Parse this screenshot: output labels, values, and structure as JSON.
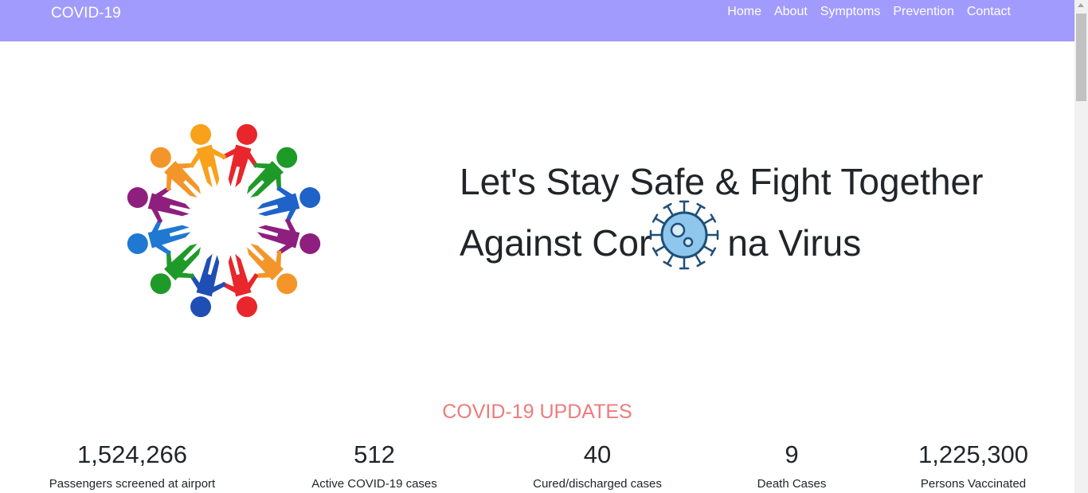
{
  "navbar": {
    "brand": "COVID-19",
    "links": [
      "Home",
      "About",
      "Symptoms",
      "Prevention",
      "Contact"
    ],
    "background": "#a29bfe"
  },
  "hero": {
    "line1": "Let's Stay Safe & Fight Together",
    "line2_before": "Against Cor",
    "line2_after": "na Virus"
  },
  "updates": {
    "title": "COVID-19 UPDATES",
    "title_color": "#ee7b7b",
    "stats": [
      {
        "value": "1,524,266",
        "label": "Passengers screened at airport"
      },
      {
        "value": "512",
        "label": "Active COVID-19 cases"
      },
      {
        "value": "40",
        "label": "Cured/discharged cases"
      },
      {
        "value": "9",
        "label": "Death Cases"
      },
      {
        "value": "1,225,300",
        "label": "Persons Vaccinated"
      }
    ]
  },
  "icons": {
    "logo": "people-circle-logo-icon",
    "virus": "coronavirus-icon"
  }
}
